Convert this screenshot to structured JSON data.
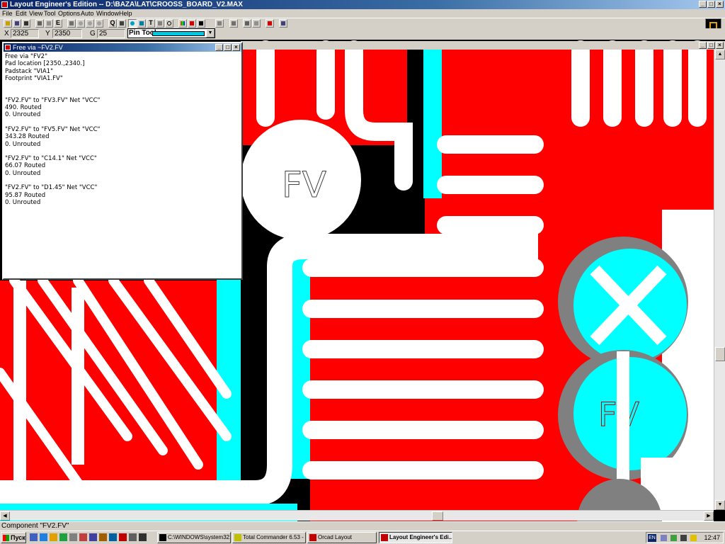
{
  "app": {
    "title": "Layout Engineer's Edition -- D:\\BAZA\\LAT\\CROOSS_BOARD_V2.MAX"
  },
  "menu": [
    "File",
    "Edit",
    "View",
    "Tool",
    "Options",
    "Auto",
    "Window",
    "Help"
  ],
  "toolbar": {
    "text_tool_glyph": "T",
    "e_glyph": "E",
    "q_glyph": "Q"
  },
  "coords": {
    "x_label": "X",
    "x_value": "2325",
    "y_label": "Y",
    "y_value": "2350",
    "g_label": "G",
    "g_value": "25"
  },
  "tool_select": {
    "value": "Pin Tool"
  },
  "info_window": {
    "title": "Free via ~FV2.FV",
    "lines": [
      "Free via \"FV2\"",
      "Pad location [2350.,2340.]",
      "Padstack \"VIA1\"",
      "Footprint \"VIA1.FV\"",
      "",
      "",
      "\"FV2.FV\" to \"FV3.FV\" Net \"VCC\"",
      "490. Routed",
      "0. Unrouted",
      "",
      "\"FV2.FV\" to \"FV5.FV\" Net \"VCC\"",
      "343.28 Routed",
      "0. Unrouted",
      "",
      "\"FV2.FV\" to \"C14.1\" Net \"VCC\"",
      "66.07 Routed",
      "0. Unrouted",
      "",
      "\"FV2.FV\" to \"D1.45\" Net \"VCC\"",
      "95.87 Routed",
      "0. Unrouted"
    ]
  },
  "board_labels": {
    "via_label_1": "FV",
    "via_label_2": "FV"
  },
  "status_line": "Component \"FV2.FV\"",
  "taskbar": {
    "start_label": "Пуск",
    "tasks": [
      "C:\\WINDOWS\\system32...",
      "Total Commander 6.53 - ...",
      "Orcad Layout",
      "Layout Engineer's Edi..."
    ],
    "lang": "EN",
    "clock": "12:47"
  },
  "colors": {
    "top_layer": "#ff0000",
    "bottom_layer": "#00ffff",
    "obstacle": "#ffffff",
    "via_ring": "#808080",
    "background": "#000000"
  }
}
